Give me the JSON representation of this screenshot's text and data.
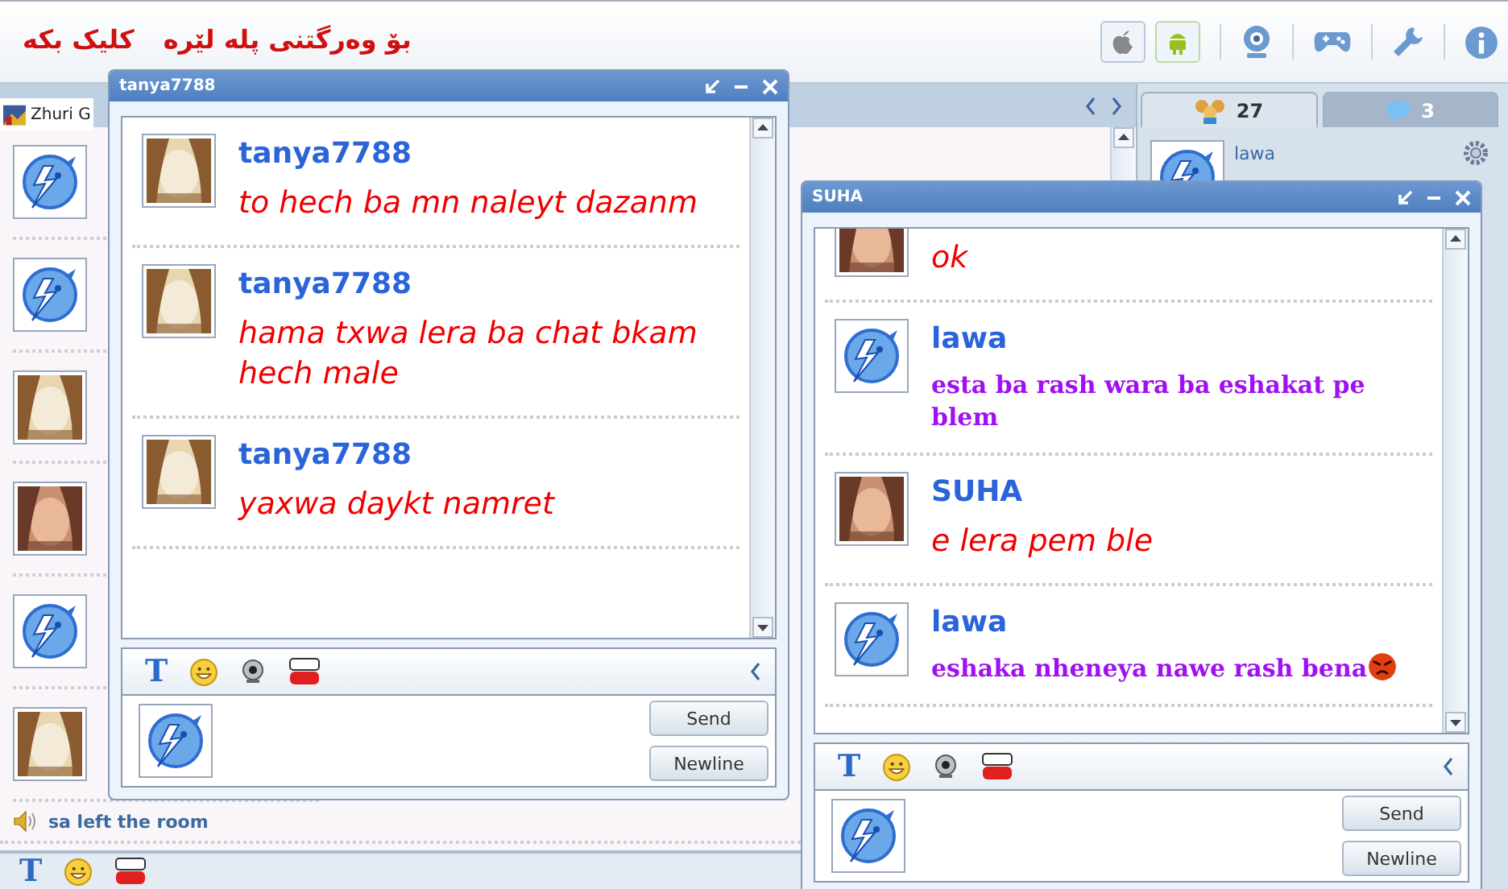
{
  "header": {
    "promo": [
      {
        "text": "بۆ وەرگتنی پلە لێرە"
      },
      {
        "text": "کلیک بکە"
      }
    ]
  },
  "room": {
    "tab": "Zhuri G",
    "avatars": [
      {
        "kind": "bird"
      },
      {
        "kind": "bird"
      },
      {
        "kind": "picture"
      },
      {
        "kind": "picture"
      },
      {
        "kind": "bird"
      },
      {
        "kind": "picture"
      }
    ],
    "notice": "sa left the room",
    "font_button": "T"
  },
  "side_tabs": [
    {
      "count": "27",
      "kind": "people",
      "selected": true
    },
    {
      "count": "3",
      "kind": "chat",
      "selected": false
    }
  ],
  "users": [
    {
      "name": "lawa"
    }
  ],
  "windows": [
    {
      "title": "tanya7788",
      "font_button": "T",
      "buttons": [
        "Send",
        "Newline"
      ],
      "messages": [
        {
          "sender": "tanya7788",
          "avatar": {
            "kind": "picture"
          },
          "kind": "script",
          "color": "#f00000",
          "text": "to hech ba mn naleyt dazanm"
        },
        {
          "sender": "tanya7788",
          "avatar": {
            "kind": "picture"
          },
          "kind": "script",
          "color": "#f00000",
          "text": "hama txwa lera ba chat bkam hech male"
        },
        {
          "sender": "tanya7788",
          "avatar": {
            "kind": "picture"
          },
          "kind": "script",
          "color": "#f00000",
          "text": "yaxwa daykt namret"
        }
      ]
    },
    {
      "title": "SUHA",
      "font_button": "T",
      "buttons": [
        "Send",
        "Newline"
      ],
      "messages": [
        {
          "avatar": {
            "kind": "picture"
          },
          "kind": "script",
          "color": "#f00000",
          "text": "ok"
        },
        {
          "sender": "lawa",
          "avatar": {
            "kind": "bird"
          },
          "kind": "serif",
          "color": "#a010f0",
          "text": "esta ba rash wara ba eshakat pe blem"
        },
        {
          "sender": "SUHA",
          "avatar": {
            "kind": "picture"
          },
          "kind": "script",
          "color": "#f00000",
          "text": "e lera pem ble"
        },
        {
          "sender": "lawa",
          "avatar": {
            "kind": "bird"
          },
          "kind": "serif",
          "color": "#a010f0",
          "text": "eshaka nheneya nawe rash bena",
          "emoji": {
            "kind": "angry"
          }
        }
      ]
    }
  ]
}
